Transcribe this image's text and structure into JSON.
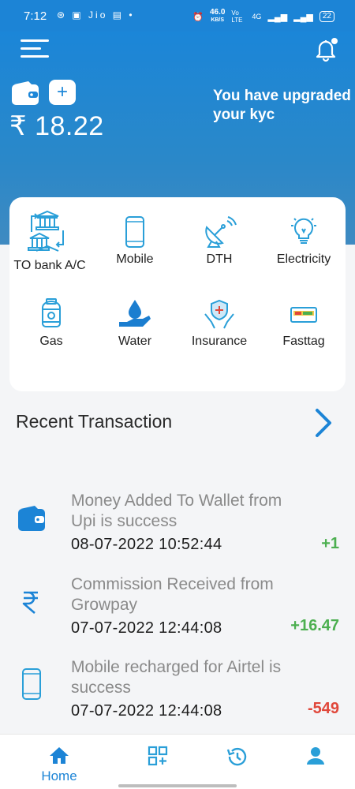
{
  "status_bar": {
    "time": "7:12",
    "left_icons": "⊛ ▣ Jio ▤ •",
    "network_speed": "46.0",
    "network_unit": "KB/S",
    "volte": "Vo LTE",
    "network": "4G",
    "battery": "22"
  },
  "header": {
    "balance": "₹ 18.22",
    "add_button": "+",
    "kyc_message": "You have upgraded your kyc"
  },
  "services": [
    {
      "label": "TO bank A/C",
      "icon": "bank-transfer-icon"
    },
    {
      "label": "Mobile",
      "icon": "mobile-phone-icon"
    },
    {
      "label": "DTH",
      "icon": "satellite-dish-icon"
    },
    {
      "label": "Electricity",
      "icon": "lightbulb-icon"
    },
    {
      "label": "Gas",
      "icon": "gas-cylinder-icon"
    },
    {
      "label": "Water",
      "icon": "water-drop-hand-icon"
    },
    {
      "label": "Insurance",
      "icon": "insurance-shield-hands-icon"
    },
    {
      "label": "Fasttag",
      "icon": "fastag-card-icon"
    }
  ],
  "recent": {
    "title": "Recent Transaction"
  },
  "transactions": [
    {
      "description": "Money Added To Wallet from Upi is success",
      "date": "08-07-2022  10:52:44",
      "amount": "+1",
      "type": "credit",
      "icon": "wallet-icon"
    },
    {
      "description": "Commission Received from Growpay",
      "date": "07-07-2022  12:44:08",
      "amount": "+16.47",
      "type": "credit",
      "icon": "rupee-icon"
    },
    {
      "description": "Mobile recharged for Airtel is success",
      "date": "07-07-2022  12:44:08",
      "amount": "-549",
      "type": "debit",
      "icon": "mobile-phone-icon"
    }
  ],
  "bottom_nav": {
    "home_label": "Home",
    "items": [
      "home-icon",
      "qr-scan-icon",
      "history-icon",
      "profile-icon"
    ]
  },
  "colors": {
    "primary": "#1c84d6",
    "credit": "#4caf50",
    "debit": "#e0473a",
    "icon_blue": "#2a9fd8"
  }
}
